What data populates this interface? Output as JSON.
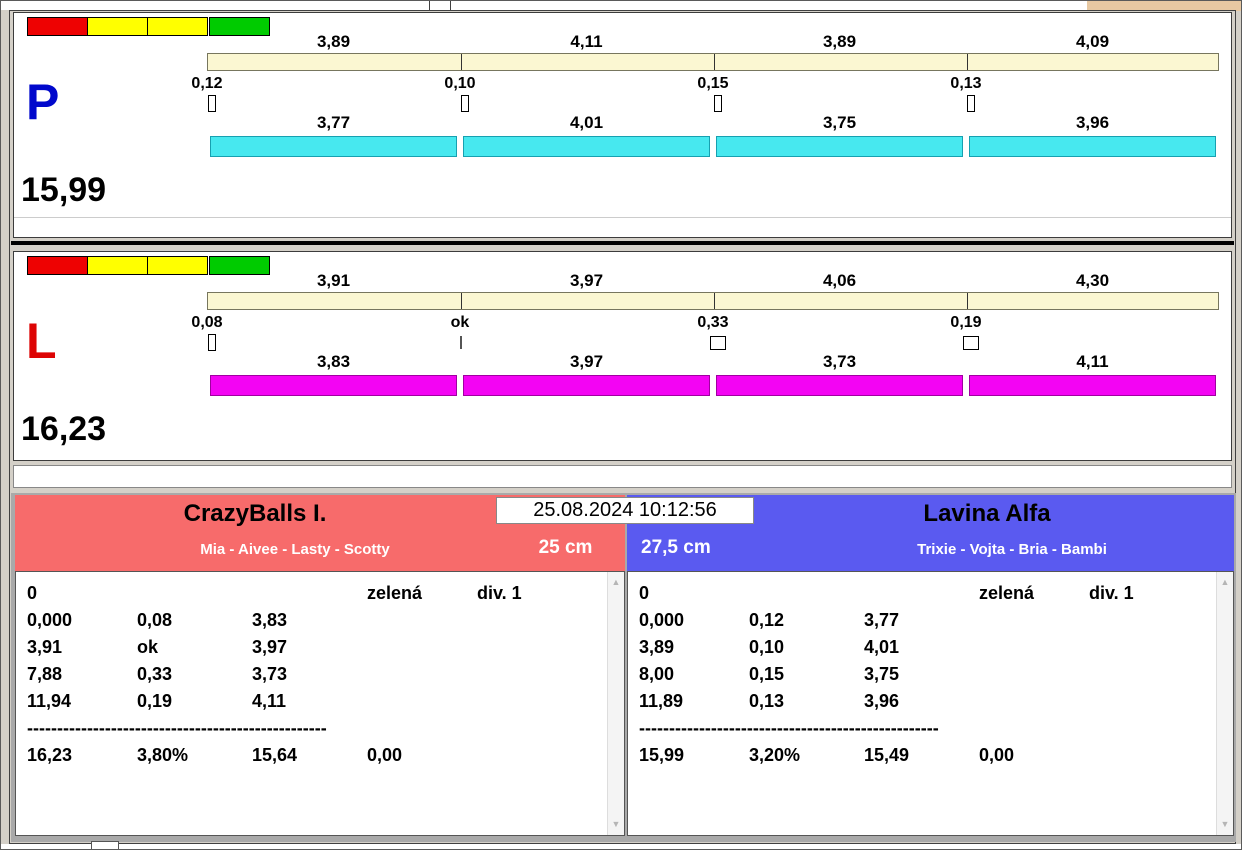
{
  "timestamp": "25.08.2024 10:12:56",
  "lanes": [
    {
      "letter": "P",
      "total": "15,99",
      "top_segments": [
        "3,89",
        "4,11",
        "3,89",
        "4,09"
      ],
      "checkpoint_values": [
        "0,12",
        "0,10",
        "0,15",
        "0,13"
      ],
      "bottom_segments": [
        "3,77",
        "4,01",
        "3,75",
        "3,96"
      ]
    },
    {
      "letter": "L",
      "total": "16,23",
      "top_segments": [
        "3,91",
        "3,97",
        "4,06",
        "4,30"
      ],
      "checkpoint_values": [
        "0,08",
        "ok",
        "0,33",
        "0,19"
      ],
      "bottom_segments": [
        "3,83",
        "3,97",
        "3,73",
        "4,11"
      ]
    }
  ],
  "teams": {
    "left": {
      "name": "CrazyBalls I.",
      "members": "Mia - Aivee - Lasty - Scotty",
      "height": "25 cm",
      "separator": "--------------------------------------------------",
      "rows": [
        [
          "0",
          "",
          "",
          "zelená",
          "div. 1"
        ],
        [
          "0,000",
          "0,08",
          "3,83",
          "",
          ""
        ],
        [
          "3,91",
          "ok",
          "3,97",
          "",
          ""
        ],
        [
          "7,88",
          "0,33",
          "3,73",
          "",
          ""
        ],
        [
          "11,94",
          "0,19",
          "4,11",
          "",
          ""
        ],
        [
          "16,23",
          "3,80%",
          "15,64",
          "0,00",
          ""
        ]
      ]
    },
    "right": {
      "name": "Lavina Alfa",
      "members": "Trixie - Vojta - Bria - Bambi",
      "height": "27,5 cm",
      "separator": "--------------------------------------------------",
      "rows": [
        [
          "0",
          "",
          "",
          "zelená",
          "div. 1"
        ],
        [
          "0,000",
          "0,12",
          "3,77",
          "",
          ""
        ],
        [
          "3,89",
          "0,10",
          "4,01",
          "",
          ""
        ],
        [
          "8,00",
          "0,15",
          "3,75",
          "",
          ""
        ],
        [
          "11,89",
          "0,13",
          "3,96",
          "",
          ""
        ],
        [
          "15,99",
          "3,20%",
          "15,49",
          "0,00",
          ""
        ]
      ]
    }
  },
  "icons": {
    "scroll_up": "▲",
    "scroll_down": "▼"
  },
  "colors": {
    "lane_p_bar": "#47e8ef",
    "lane_l_bar": "#f304f3",
    "lane_p_letter": "#0008cc",
    "lane_l_letter": "#dd0404",
    "left_header": "#f76b6b",
    "right_header": "#5a5af0",
    "track": "#fbf7d2",
    "light_red": "#ee0202",
    "light_yellow": "#ffff00",
    "light_green": "#00cb00"
  }
}
